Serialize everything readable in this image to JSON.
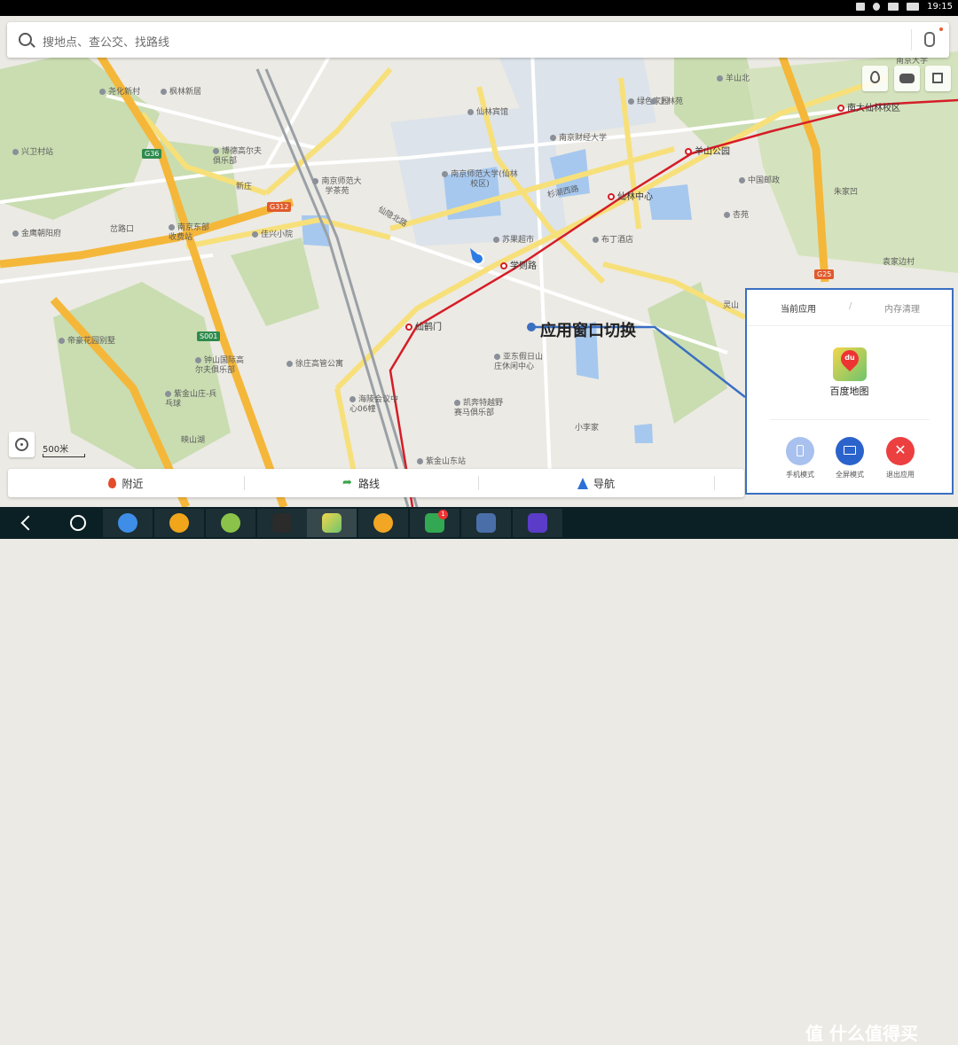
{
  "status_bar": {
    "time": "19:15"
  },
  "search": {
    "placeholder": "搜地点、查公交、找路线"
  },
  "map": {
    "labels": [
      {
        "text": "南京大学",
        "kind": "plain"
      },
      {
        "text": "仙林宾馆",
        "kind": "poi"
      },
      {
        "text": "南京财经大学",
        "kind": "poi"
      },
      {
        "text": "绿色家园",
        "kind": "poi"
      },
      {
        "text": "南京师范大学(仙林校区)",
        "kind": "poi"
      },
      {
        "text": "南京师范大学茶苑",
        "kind": "poi"
      },
      {
        "text": "博德高尔夫俱乐部",
        "kind": "poi"
      },
      {
        "text": "新庄",
        "kind": "plain"
      },
      {
        "text": "枫林新居",
        "kind": "poi"
      },
      {
        "text": "尧化新村",
        "kind": "poi"
      },
      {
        "text": "兴卫村站",
        "kind": "poi"
      },
      {
        "text": "金鹰朝阳府",
        "kind": "poi"
      },
      {
        "text": "岔路口",
        "kind": "plain"
      },
      {
        "text": "南京东部收费站",
        "kind": "poi"
      },
      {
        "text": "佳兴小院",
        "kind": "poi"
      },
      {
        "text": "苏果超市",
        "kind": "poi"
      },
      {
        "text": "布丁酒店",
        "kind": "poi"
      },
      {
        "text": "中国邮政",
        "kind": "poi"
      },
      {
        "text": "杏苑",
        "kind": "poi"
      },
      {
        "text": "朱家凹",
        "kind": "plain"
      },
      {
        "text": "袁家边村",
        "kind": "plain"
      },
      {
        "text": "灵山",
        "kind": "plain"
      },
      {
        "text": "帝豪花园别墅",
        "kind": "poi"
      },
      {
        "text": "钟山国际高尔夫俱乐部",
        "kind": "poi"
      },
      {
        "text": "徐庄高管公寓",
        "kind": "poi"
      },
      {
        "text": "亚东假日山庄休闲中心",
        "kind": "poi"
      },
      {
        "text": "凯奔特越野赛马俱乐部",
        "kind": "poi"
      },
      {
        "text": "海陵会议中心06幢",
        "kind": "poi"
      },
      {
        "text": "小李家",
        "kind": "plain"
      },
      {
        "text": "映山湖",
        "kind": "plain"
      },
      {
        "text": "紫金山庄-兵乓球",
        "kind": "poi"
      },
      {
        "text": "紫金山东站",
        "kind": "poi"
      },
      {
        "text": "上林苑",
        "kind": "poi"
      },
      {
        "text": "羊山北",
        "kind": "poi"
      },
      {
        "text": "羊山公园",
        "kind": "station"
      },
      {
        "text": "南大仙林校区",
        "kind": "station"
      },
      {
        "text": "仙林中心",
        "kind": "station"
      },
      {
        "text": "学则路",
        "kind": "station"
      },
      {
        "text": "仙鹤门",
        "kind": "station"
      },
      {
        "text": "杉湖西路",
        "kind": "plain"
      },
      {
        "text": "仙隐北路",
        "kind": "plain"
      }
    ],
    "shields": [
      "G36",
      "G312",
      "S001",
      "G25",
      "G2501"
    ],
    "scale": "500米",
    "annotation": "应用窗口切换",
    "colors": {
      "metro_line": "#d51d27",
      "highway": "#f4b73a",
      "water": "#a6c8ee",
      "green": "#c9ddb1",
      "callout": "#3a6fc2"
    }
  },
  "bottom_bar": {
    "nearby": "附近",
    "route": "路线",
    "navigate": "导航"
  },
  "switcher": {
    "tab_current": "当前应用",
    "tab_memory": "内存清理",
    "app_name": "百度地图",
    "app_icon_text": "du",
    "modes": [
      {
        "label": "手机模式",
        "icon": "phone-icon",
        "color": "#a8c1ee"
      },
      {
        "label": "全屏模式",
        "icon": "monitor-icon",
        "color": "#2b63cc"
      },
      {
        "label": "退出应用",
        "icon": "close-icon",
        "color": "#ec3f3f"
      }
    ]
  },
  "nav_bar": {
    "badge_count": "1"
  },
  "watermark": "值 什么值得买"
}
